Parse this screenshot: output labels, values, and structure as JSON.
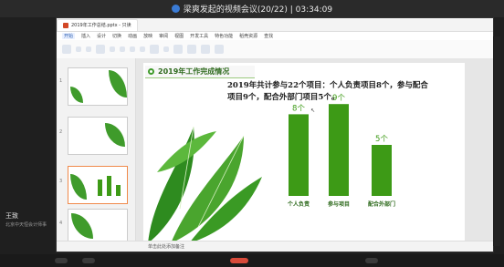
{
  "meeting": {
    "title": "梁爽发起的视频会议(20/22) | 03:34:09",
    "participant_name": "王致",
    "participant_sub": "北京中天恒会计师事"
  },
  "wps": {
    "tabs": [
      "2019年工作总结.pptx - 只读"
    ],
    "menu": [
      "开始",
      "插入",
      "设计",
      "切换",
      "动画",
      "放映",
      "审阅",
      "视图",
      "开发工具",
      "特色功能",
      "稻壳资源",
      "查找"
    ],
    "active_menu": "开始",
    "status_text": "单击此处添加备注"
  },
  "slide": {
    "title": "2019年工作完成情况",
    "summary": "2019年共计参与22个项目：个人负责项目8个，参与配合项目9个，配合外部门项目5个。"
  },
  "colors": {
    "accent": "#3f9b2b",
    "bar": "#3d9a16",
    "title_text": "#2e6a1d"
  },
  "chart_data": {
    "type": "bar",
    "categories": [
      "个人负责",
      "参与项目",
      "配合外部门"
    ],
    "values": [
      8,
      9,
      5
    ],
    "data_labels": [
      "8个",
      "9个",
      "5个"
    ],
    "ylim": [
      0,
      10
    ]
  }
}
